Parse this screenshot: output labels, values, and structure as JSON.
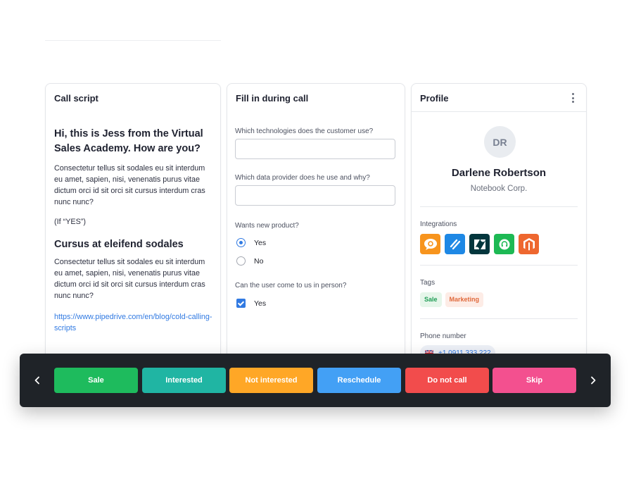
{
  "call_script": {
    "title": "Call script",
    "greeting": "Hi, this is Jess from the Virtual Sales Academy. How are you?",
    "paragraph1": "Consectetur tellus sit sodales eu sit interdum eu amet, sapien, nisi, venenatis purus vitae dictum orci id sit orci sit cursus interdum cras nunc nunc?",
    "if_note": "(If “YES”)",
    "heading2": "Cursus at eleifend sodales",
    "paragraph2": "Consectetur tellus sit sodales eu sit interdum eu amet, sapien, nisi, venenatis purus vitae dictum orci id sit orci sit cursus interdum cras nunc nunc?",
    "link": "https://www.pipedrive.com/en/blog/cold-calling-scripts"
  },
  "form": {
    "title": "Fill in during call",
    "q1": "Which technologies does the customer use?",
    "q1_value": "",
    "q2": "Which data provider does he use and why?",
    "q2_value": "",
    "q3": "Wants new product?",
    "q3_options": [
      "Yes",
      "No"
    ],
    "q3_selected": "Yes",
    "q4": "Can the user come to us in person?",
    "q4_option": "Yes",
    "q4_checked": true
  },
  "profile": {
    "title": "Profile",
    "initials": "DR",
    "name": "Darlene Robertson",
    "company": "Notebook Corp.",
    "integrations_label": "Integrations",
    "integrations": [
      {
        "icon": "chat-bubble-icon",
        "color": "#f7941d"
      },
      {
        "icon": "stripes-icon",
        "color": "#1e88e5"
      },
      {
        "icon": "zendesk-icon",
        "color": "#03363d"
      },
      {
        "icon": "headset-icon",
        "color": "#1db954"
      },
      {
        "icon": "magento-icon",
        "color": "#ee672f"
      }
    ],
    "tags_label": "Tags",
    "tags": [
      {
        "label": "Sale",
        "bg": "#e6f6ea",
        "color": "#1f9d55"
      },
      {
        "label": "Marketing",
        "bg": "#fdece6",
        "color": "#e0693b"
      }
    ],
    "phone_label": "Phone number",
    "phone": "+1 0911 333 222"
  },
  "actions": [
    {
      "label": "Sale",
      "color": "#1ebb5d"
    },
    {
      "label": "Interested",
      "color": "#20b5a3"
    },
    {
      "label": "Not interested",
      "color": "#ffa726"
    },
    {
      "label": "Reschedule",
      "color": "#43a0f5"
    },
    {
      "label": "Do not call",
      "color": "#f24c4c"
    },
    {
      "label": "Skip",
      "color": "#f3508f"
    }
  ]
}
